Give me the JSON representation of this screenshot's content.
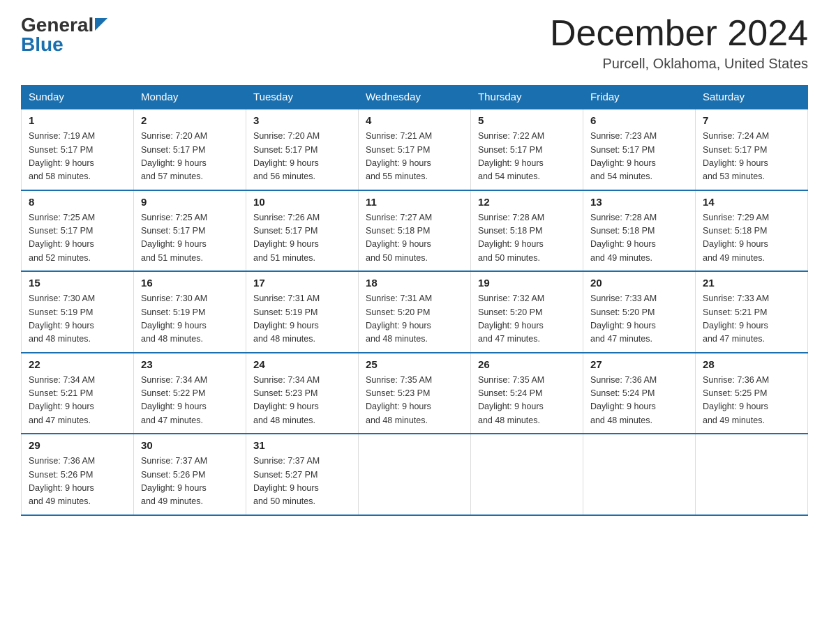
{
  "header": {
    "logo_text_general": "General",
    "logo_text_blue": "Blue",
    "title": "December 2024",
    "location": "Purcell, Oklahoma, United States"
  },
  "days_of_week": [
    "Sunday",
    "Monday",
    "Tuesday",
    "Wednesday",
    "Thursday",
    "Friday",
    "Saturday"
  ],
  "weeks": [
    [
      {
        "day": "1",
        "sunrise": "7:19 AM",
        "sunset": "5:17 PM",
        "daylight": "9 hours and 58 minutes."
      },
      {
        "day": "2",
        "sunrise": "7:20 AM",
        "sunset": "5:17 PM",
        "daylight": "9 hours and 57 minutes."
      },
      {
        "day": "3",
        "sunrise": "7:20 AM",
        "sunset": "5:17 PM",
        "daylight": "9 hours and 56 minutes."
      },
      {
        "day": "4",
        "sunrise": "7:21 AM",
        "sunset": "5:17 PM",
        "daylight": "9 hours and 55 minutes."
      },
      {
        "day": "5",
        "sunrise": "7:22 AM",
        "sunset": "5:17 PM",
        "daylight": "9 hours and 54 minutes."
      },
      {
        "day": "6",
        "sunrise": "7:23 AM",
        "sunset": "5:17 PM",
        "daylight": "9 hours and 54 minutes."
      },
      {
        "day": "7",
        "sunrise": "7:24 AM",
        "sunset": "5:17 PM",
        "daylight": "9 hours and 53 minutes."
      }
    ],
    [
      {
        "day": "8",
        "sunrise": "7:25 AM",
        "sunset": "5:17 PM",
        "daylight": "9 hours and 52 minutes."
      },
      {
        "day": "9",
        "sunrise": "7:25 AM",
        "sunset": "5:17 PM",
        "daylight": "9 hours and 51 minutes."
      },
      {
        "day": "10",
        "sunrise": "7:26 AM",
        "sunset": "5:17 PM",
        "daylight": "9 hours and 51 minutes."
      },
      {
        "day": "11",
        "sunrise": "7:27 AM",
        "sunset": "5:18 PM",
        "daylight": "9 hours and 50 minutes."
      },
      {
        "day": "12",
        "sunrise": "7:28 AM",
        "sunset": "5:18 PM",
        "daylight": "9 hours and 50 minutes."
      },
      {
        "day": "13",
        "sunrise": "7:28 AM",
        "sunset": "5:18 PM",
        "daylight": "9 hours and 49 minutes."
      },
      {
        "day": "14",
        "sunrise": "7:29 AM",
        "sunset": "5:18 PM",
        "daylight": "9 hours and 49 minutes."
      }
    ],
    [
      {
        "day": "15",
        "sunrise": "7:30 AM",
        "sunset": "5:19 PM",
        "daylight": "9 hours and 48 minutes."
      },
      {
        "day": "16",
        "sunrise": "7:30 AM",
        "sunset": "5:19 PM",
        "daylight": "9 hours and 48 minutes."
      },
      {
        "day": "17",
        "sunrise": "7:31 AM",
        "sunset": "5:19 PM",
        "daylight": "9 hours and 48 minutes."
      },
      {
        "day": "18",
        "sunrise": "7:31 AM",
        "sunset": "5:20 PM",
        "daylight": "9 hours and 48 minutes."
      },
      {
        "day": "19",
        "sunrise": "7:32 AM",
        "sunset": "5:20 PM",
        "daylight": "9 hours and 47 minutes."
      },
      {
        "day": "20",
        "sunrise": "7:33 AM",
        "sunset": "5:20 PM",
        "daylight": "9 hours and 47 minutes."
      },
      {
        "day": "21",
        "sunrise": "7:33 AM",
        "sunset": "5:21 PM",
        "daylight": "9 hours and 47 minutes."
      }
    ],
    [
      {
        "day": "22",
        "sunrise": "7:34 AM",
        "sunset": "5:21 PM",
        "daylight": "9 hours and 47 minutes."
      },
      {
        "day": "23",
        "sunrise": "7:34 AM",
        "sunset": "5:22 PM",
        "daylight": "9 hours and 47 minutes."
      },
      {
        "day": "24",
        "sunrise": "7:34 AM",
        "sunset": "5:23 PM",
        "daylight": "9 hours and 48 minutes."
      },
      {
        "day": "25",
        "sunrise": "7:35 AM",
        "sunset": "5:23 PM",
        "daylight": "9 hours and 48 minutes."
      },
      {
        "day": "26",
        "sunrise": "7:35 AM",
        "sunset": "5:24 PM",
        "daylight": "9 hours and 48 minutes."
      },
      {
        "day": "27",
        "sunrise": "7:36 AM",
        "sunset": "5:24 PM",
        "daylight": "9 hours and 48 minutes."
      },
      {
        "day": "28",
        "sunrise": "7:36 AM",
        "sunset": "5:25 PM",
        "daylight": "9 hours and 49 minutes."
      }
    ],
    [
      {
        "day": "29",
        "sunrise": "7:36 AM",
        "sunset": "5:26 PM",
        "daylight": "9 hours and 49 minutes."
      },
      {
        "day": "30",
        "sunrise": "7:37 AM",
        "sunset": "5:26 PM",
        "daylight": "9 hours and 49 minutes."
      },
      {
        "day": "31",
        "sunrise": "7:37 AM",
        "sunset": "5:27 PM",
        "daylight": "9 hours and 50 minutes."
      },
      null,
      null,
      null,
      null
    ]
  ],
  "labels": {
    "sunrise": "Sunrise:",
    "sunset": "Sunset:",
    "daylight": "Daylight:"
  }
}
